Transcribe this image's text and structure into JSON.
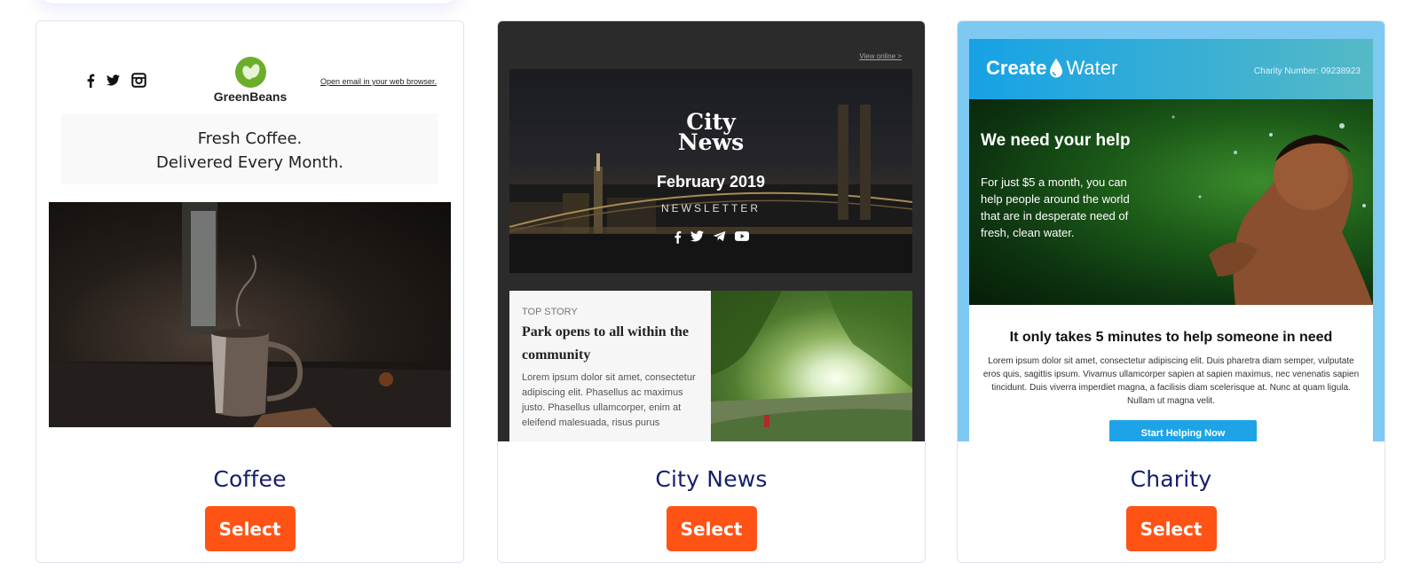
{
  "cards": [
    {
      "title": "Coffee",
      "select_label": "Select",
      "preview": {
        "brand": "GreenBeans",
        "browser_link": "Open email in your web browser.",
        "headline_line1": "Fresh Coffee.",
        "headline_line2": "Delivered Every Month."
      }
    },
    {
      "title": "City News",
      "select_label": "Select",
      "preview": {
        "view_online": "View online >",
        "logo_line1": "City",
        "logo_line2": "News",
        "date": "February 2019",
        "newsletter": "NEWSLETTER",
        "kicker": "TOP STORY",
        "headline": "Park opens to all within the community",
        "body": "Lorem ipsum dolor sit amet, consectetur adipiscing elit. Phasellus ac maximus justo. Phasellus ullamcorper, enim at eleifend malesuada, risus purus"
      }
    },
    {
      "title": "Charity",
      "select_label": "Select",
      "preview": {
        "logo_bold": "Create",
        "logo_light": "Water",
        "charity_number": "Charity Number: 09238923",
        "hero_title": "We need your help",
        "hero_text": "For just $5 a month, you can help people around the world that are in desperate need of fresh, clean water.",
        "body_title": "It only takes 5 minutes to help someone in need",
        "body_text": "Lorem ipsum dolor sit amet, consectetur adipiscing elit. Duis pharetra diam semper, vulputate eros quis, sagittis ipsum. Vivamus ullamcorper sapien at sapien maximus, nec venenatis sapien tincidunt. Duis viverra imperdiet magna, a facilisis diam scelerisque at. Nunc at quam ligula. Nullam ut magna velit.",
        "cta": "Start Helping Now"
      }
    }
  ],
  "colors": {
    "select_button": "#ff5316",
    "card_title": "#14206b",
    "card_border": "#dfe3f1"
  }
}
